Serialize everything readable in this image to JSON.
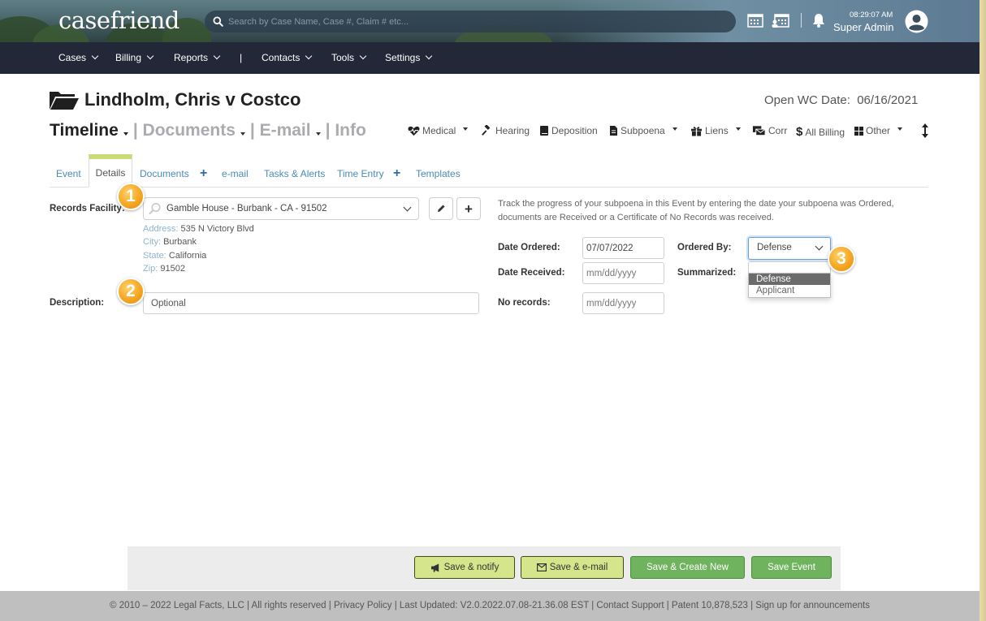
{
  "header": {
    "logo": "casefriend",
    "search_placeholder": "Search by Case Name, Case #, Claim # etc...",
    "time": "08:29:07 AM",
    "user": "Super Admin"
  },
  "nav": {
    "items": [
      "Cases",
      "Billing",
      "Reports",
      "Contacts",
      "Tools",
      "Settings"
    ],
    "separator": "|"
  },
  "case": {
    "title": "Lindholm, Chris v Costco",
    "open_wc_label": "Open WC Date:",
    "open_wc_date": "06/16/2021"
  },
  "section_nav": {
    "timeline": "Timeline",
    "documents": "| Documents",
    "email": "| E-mail",
    "info": "| Info"
  },
  "quick_links": {
    "medical": "Medical",
    "hearing": "Hearing",
    "deposition": "Deposition",
    "subpoena": "Subpoena",
    "liens": "Liens",
    "corr": "Corr",
    "all_billing": "All Billing",
    "other": "Other"
  },
  "tabs": {
    "event": "Event",
    "details": "Details",
    "documents": "Documents",
    "email": "e-mail",
    "tasks": "Tasks & Alerts",
    "time_entry": "Time Entry",
    "templates": "Templates"
  },
  "form": {
    "records_facility_label": "Records Facility:",
    "records_facility_value": "Gamble House - Burbank - CA - 91502",
    "address_label": "Address:",
    "address": "535 N Victory Blvd",
    "city_label": "City:",
    "city": "Burbank",
    "state_label": "State:",
    "state": "California",
    "zip_label": "Zip:",
    "zip": "91502",
    "description_label": "Description:",
    "description_placeholder": "Optional",
    "help_text": "Track the progress of your subpoena in this Event by entering the date your subpoena was Ordered, documents are Received or a Certificate of No Records was received.",
    "date_ordered_label": "Date Ordered:",
    "date_ordered": "07/07/2022",
    "date_received_label": "Date Received:",
    "date_received_placeholder": "mm/dd/yyyy",
    "no_records_label": "No records:",
    "no_records_placeholder": "mm/dd/yyyy",
    "ordered_by_label": "Ordered By:",
    "ordered_by_value": "Defense",
    "summarized_label": "Summarized:",
    "ordered_by_options": [
      "Defense",
      "Applicant"
    ]
  },
  "badges": [
    "1",
    "2",
    "3"
  ],
  "buttons": {
    "save_notify": "Save & notify",
    "save_email": "Save & e-mail",
    "save_create": "Save & Create New",
    "save_event": "Save Event"
  },
  "footer": "© 2010 – 2022 Legal Facts, LLC | All rights reserved | Privacy Policy | Last Updated: V2.0.2022.07.08-21.36.08 EST | Contact Support | Patent 10,878,523 | Sign up for announcements",
  "colors": {
    "navbar": "#222838",
    "accent_tab": "#c9dc77",
    "lime_button": "#d5e58b",
    "green_button": "#6fb35e",
    "badge": "#f5a623",
    "link": "#4a8bb5"
  }
}
